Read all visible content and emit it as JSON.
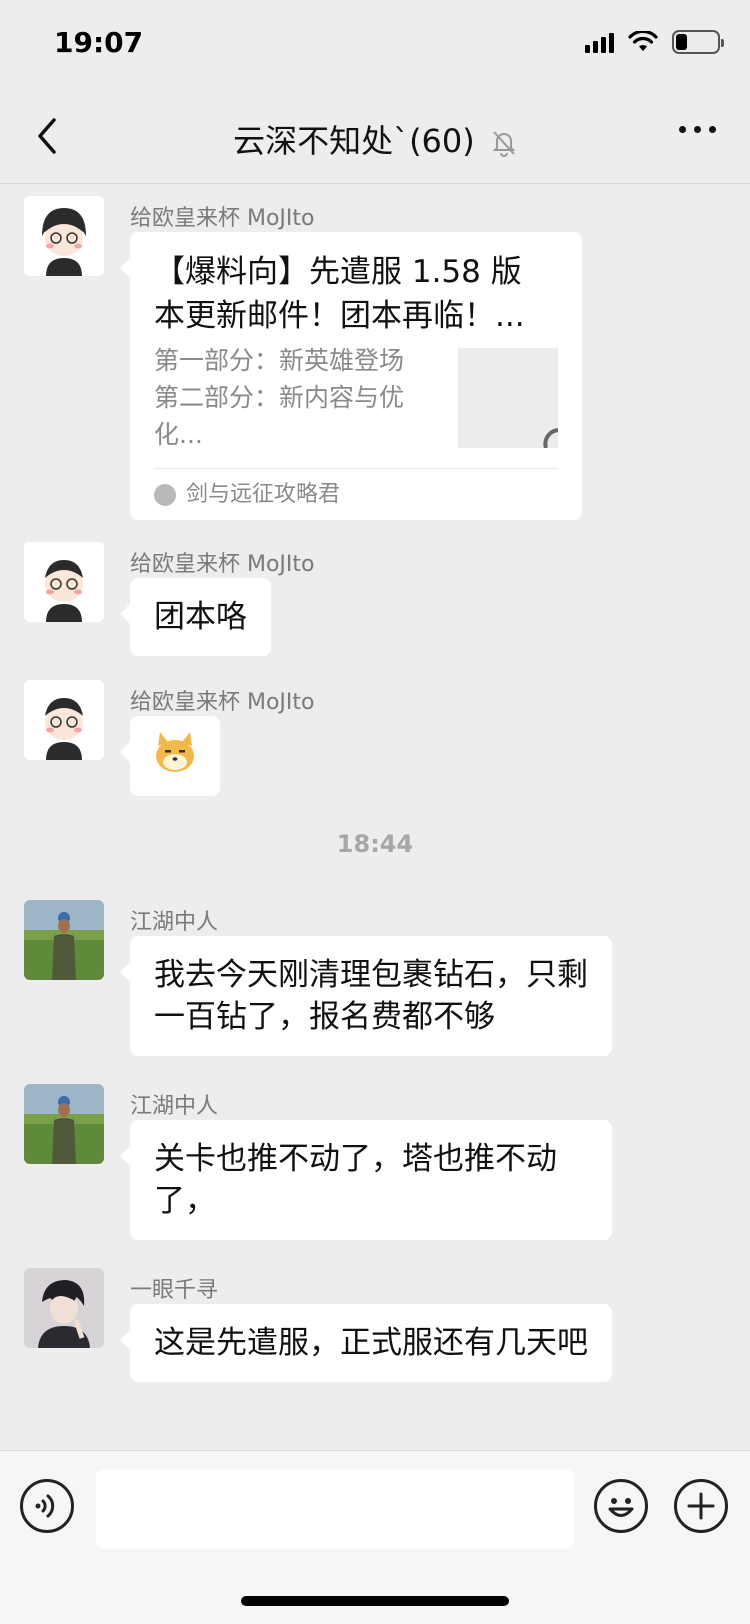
{
  "status_bar": {
    "time": "19:07"
  },
  "header": {
    "title": "云深不知处`(60)"
  },
  "messages": [
    {
      "sender": "给欧皇来杯 MoJIto",
      "type": "link",
      "card_title": "【爆料向】先遣服 1.58 版本更新邮件！团本再临！...",
      "card_desc": "第一部分：新英雄登场\n第二部分：新内容与优化...",
      "card_source": "剑与远征攻略君"
    },
    {
      "sender": "给欧皇来杯 MoJIto",
      "type": "text",
      "text": "团本咯"
    },
    {
      "sender": "给欧皇来杯 MoJIto",
      "type": "sticker",
      "sticker_icon": "doge-icon"
    },
    {
      "type": "time",
      "text": "18:44"
    },
    {
      "sender": "江湖中人",
      "type": "text",
      "text": "我去今天刚清理包裹钻石，只剩一百钻了，报名费都不够"
    },
    {
      "sender": "江湖中人",
      "type": "text",
      "text": "关卡也推不动了，塔也推不动了，"
    },
    {
      "sender": "一眼千寻",
      "type": "text",
      "text": "这是先遣服，正式服还有几天吧"
    }
  ],
  "input_bar": {
    "placeholder": ""
  }
}
